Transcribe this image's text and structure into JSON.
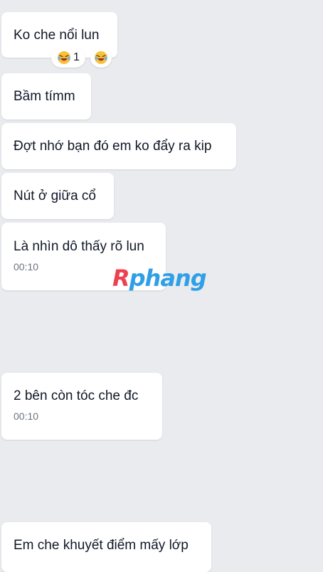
{
  "messages": [
    {
      "text": "Ko che nổi lun"
    },
    {
      "text": "Bầm tímm"
    },
    {
      "text": "Đợt nhớ bạn đó em ko đẩy ra kip"
    },
    {
      "text": "Nút ở giữa cổ"
    },
    {
      "text": "Là nhìn dô thấy rõ lun",
      "time": "00:10"
    },
    {
      "text": "2 bên còn tóc che đc",
      "time": "00:10"
    },
    {
      "text": "Em che khuyết điểm mấy lớp"
    }
  ],
  "reactions": {
    "summary": {
      "emoji": "laughing-crying-emoji",
      "count": "1"
    },
    "add": {
      "emoji": "laughing-crying-emoji"
    }
  },
  "watermark": {
    "part1": "R",
    "part2": "phang"
  },
  "colors": {
    "background": "#e9ebef",
    "bubble": "#ffffff",
    "time": "#6b7280",
    "accent_red": "#ef4050",
    "accent_blue": "#2f9fe6"
  }
}
